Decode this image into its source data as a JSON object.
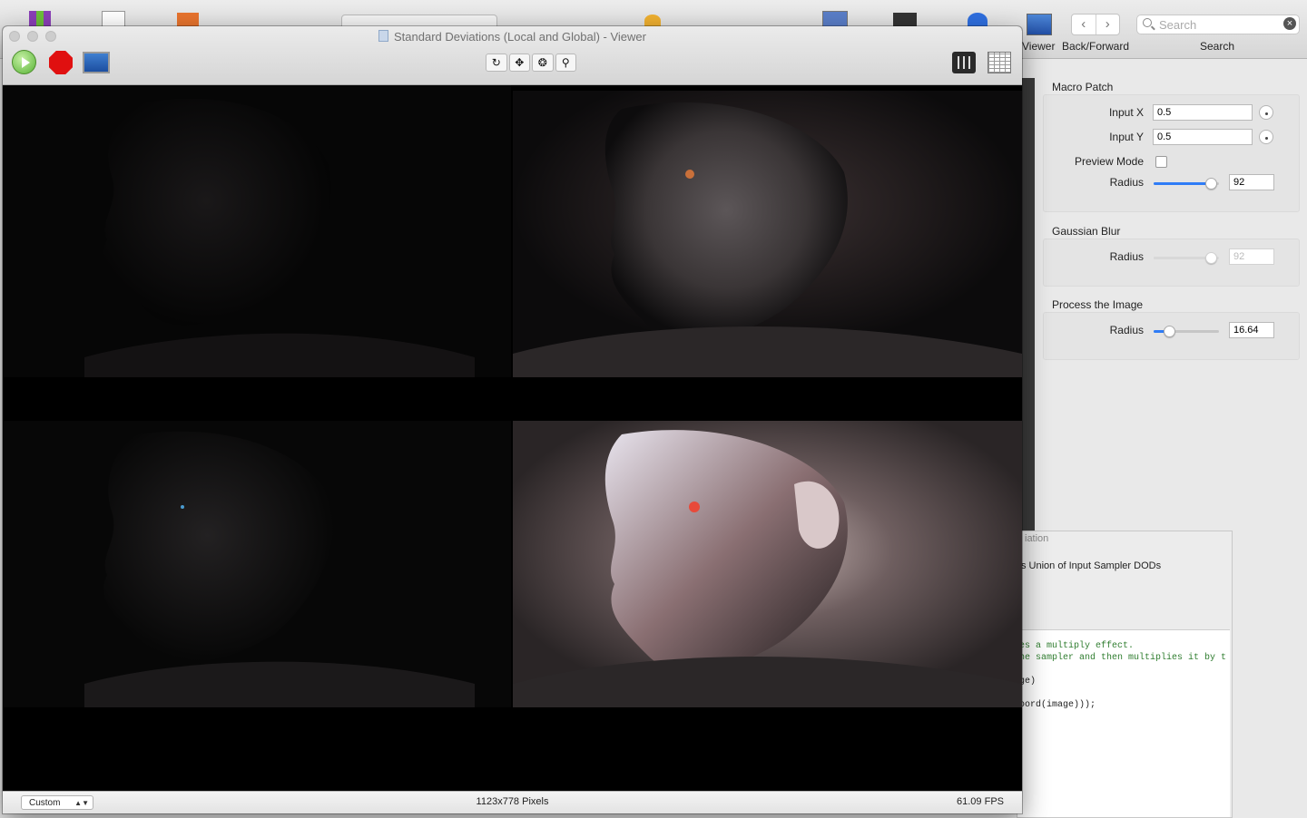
{
  "app_toolbar": {
    "viewer_label": "Viewer",
    "backforward_label": "Back/Forward",
    "search_label": "Search",
    "search_placeholder": "Search"
  },
  "viewer": {
    "title": "Standard Deviations (Local and Global) - Viewer",
    "status": {
      "mode": "Custom",
      "dimensions": "1123x778 Pixels",
      "fps": "61.09 FPS"
    }
  },
  "inspector": {
    "macro_patch": {
      "title": "Macro Patch",
      "input_x_label": "Input X",
      "input_x_value": "0.5",
      "input_y_label": "Input Y",
      "input_y_value": "0.5",
      "preview_mode_label": "Preview Mode",
      "preview_mode_checked": false,
      "radius_label": "Radius",
      "radius_value": "92",
      "radius_fraction": 0.87
    },
    "gaussian_blur": {
      "title": "Gaussian Blur",
      "radius_label": "Radius",
      "radius_value": "92",
      "radius_fraction": 0.87
    },
    "process_image": {
      "title": "Process the Image",
      "radius_label": "Radius",
      "radius_value": "16.64",
      "radius_fraction": 0.23
    }
  },
  "info_window": {
    "title": "iation",
    "line": "s Union of Input Sampler DODs",
    "code": [
      {
        "text": "es a multiply effect.",
        "comment": true
      },
      {
        "text": "he sampler and then multiplies it by t",
        "comment": true
      },
      {
        "text": "",
        "comment": false
      },
      {
        "text": "ge)",
        "comment": false
      },
      {
        "text": "",
        "comment": false
      },
      {
        "text": "oord(image)));",
        "comment": false
      }
    ]
  },
  "colors": {
    "accent": "#2f7cf6",
    "stop": "#e01010",
    "run": "#57b336"
  }
}
